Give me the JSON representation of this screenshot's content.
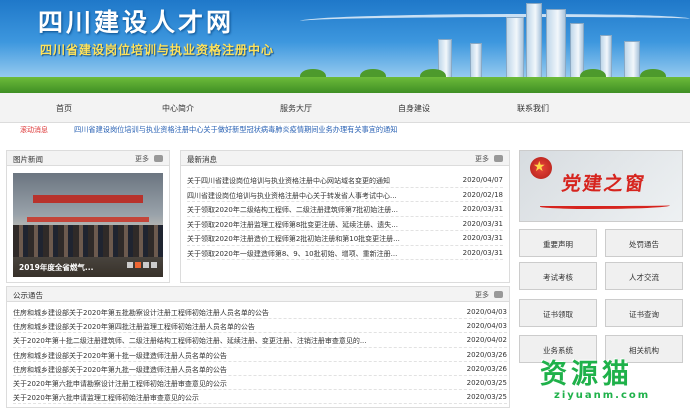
{
  "header": {
    "site_name": "四川建设人才网",
    "subtitle": "四川省建设岗位培训与执业资格注册中心"
  },
  "nav": {
    "items": [
      "首页",
      "中心简介",
      "服务大厅",
      "自身建设",
      "联系我们"
    ]
  },
  "ticker": {
    "tag": "滚动消息",
    "text": "四川省建设岗位培训与执业资格注册中心关于做好新型冠状病毒肺炎疫情期间业务办理有关事宜的通知"
  },
  "photo_news": {
    "title": "图片新闻",
    "more": "更多",
    "caption": "2019年度全省燃气...",
    "slide_count": 4,
    "active_slide": 1
  },
  "latest_news": {
    "title": "最新消息",
    "more": "更多",
    "items": [
      {
        "title": "关于四川省建设岗位培训与执业资格注册中心网站域名变更的通知",
        "date": "2020/04/07"
      },
      {
        "title": "四川省建设岗位培训与执业资格注册中心关于转发省人事考试中心...",
        "date": "2020/02/18"
      },
      {
        "title": "关于领取2020年二级结构工程师、二级注册建筑师第7批初始注册...",
        "date": "2020/03/31"
      },
      {
        "title": "关于领取2020年注册监理工程师第8批变更注册、延续注册、遗失...",
        "date": "2020/03/31"
      },
      {
        "title": "关于领取2020年注册造价工程师第2批初始注册和第10批变更注册...",
        "date": "2020/03/31"
      },
      {
        "title": "关于领取2020年一级建造师第8、9、10批初始、增项、重新注册...",
        "date": "2020/03/31"
      }
    ]
  },
  "notices": {
    "title": "公示通告",
    "more": "更多",
    "items": [
      {
        "title": "住房和城乡建设部关于2020年第五批勘察设计注册工程师初始注册人员名单的公告",
        "date": "2020/04/03"
      },
      {
        "title": "住房和城乡建设部关于2020年第四批注册监理工程师初始注册人员名单的公告",
        "date": "2020/04/03"
      },
      {
        "title": "关于2020年第十批二级注册建筑师、二级注册结构工程师初始注册、延续注册、变更注册、注销注册审查意见的...",
        "date": "2020/04/02"
      },
      {
        "title": "住房和城乡建设部关于2020年第十批一级建造师注册人员名单的公告",
        "date": "2020/03/26"
      },
      {
        "title": "住房和城乡建设部关于2020年第九批一级建造师注册人员名单的公告",
        "date": "2020/03/26"
      },
      {
        "title": "关于2020年第六批申请勘察设计注册工程师初始注册审查意见的公示",
        "date": "2020/03/25"
      },
      {
        "title": "关于2020年第六批申请监理工程师初始注册审查意见的公示",
        "date": "2020/03/25"
      }
    ]
  },
  "party_banner": {
    "text": "党建之窗"
  },
  "quick_links": [
    "重要声明",
    "处罚通告",
    "考试考核",
    "人才交流",
    "证书领取",
    "证书查询",
    "业务系统",
    "相关机构"
  ],
  "watermark": {
    "big": "资源猫",
    "small": "ziyuanm.com"
  },
  "colors": {
    "header_blue": "#1f78c9",
    "subtitle_yellow": "#ffe25a",
    "ticker_red": "#d33",
    "ticker_blue": "#2a62b4",
    "party_red": "#d6241e",
    "watermark_green": "#1fb14a"
  }
}
